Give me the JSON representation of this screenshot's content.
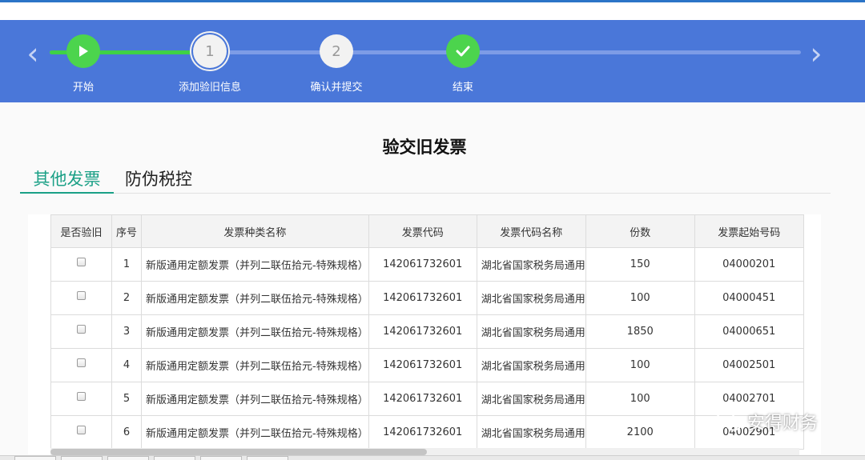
{
  "steps": {
    "items": [
      {
        "label": "开始",
        "icon": "play-icon"
      },
      {
        "label": "添加验旧信息",
        "number": "1"
      },
      {
        "label": "确认并提交",
        "number": "2"
      },
      {
        "label": "结束",
        "icon": "check-icon"
      }
    ],
    "current_index": 1,
    "accent_color": "#4cd44d",
    "bar_color": "#4a77d9"
  },
  "page": {
    "title": "验交旧发票"
  },
  "tabs": [
    {
      "label": "其他发票",
      "active": true
    },
    {
      "label": "防伪税控",
      "active": false
    }
  ],
  "table": {
    "headers": [
      "是否验旧",
      "序号",
      "发票种类名称",
      "发票代码",
      "发票代码名称",
      "份数",
      "发票起始号码"
    ],
    "rows": [
      {
        "seq": "1",
        "name": "新版通用定额发票（并列二联伍拾元-特殊规格）",
        "code": "142061732601",
        "code_name": "湖北省国家税务局通用",
        "count": "150",
        "start": "04000201",
        "checked": false
      },
      {
        "seq": "2",
        "name": "新版通用定额发票（并列二联伍拾元-特殊规格）",
        "code": "142061732601",
        "code_name": "湖北省国家税务局通用",
        "count": "100",
        "start": "04000451",
        "checked": false
      },
      {
        "seq": "3",
        "name": "新版通用定额发票（并列二联伍拾元-特殊规格）",
        "code": "142061732601",
        "code_name": "湖北省国家税务局通用",
        "count": "1850",
        "start": "04000651",
        "checked": false
      },
      {
        "seq": "4",
        "name": "新版通用定额发票（并列二联伍拾元-特殊规格）",
        "code": "142061732601",
        "code_name": "湖北省国家税务局通用",
        "count": "100",
        "start": "04002501",
        "checked": false
      },
      {
        "seq": "5",
        "name": "新版通用定额发票（并列二联伍拾元-特殊规格）",
        "code": "142061732601",
        "code_name": "湖北省国家税务局通用",
        "count": "100",
        "start": "04002701",
        "checked": false
      },
      {
        "seq": "6",
        "name": "新版通用定额发票（并列二联伍拾元-特殊规格）",
        "code": "142061732601",
        "code_name": "湖北省国家税务局通用",
        "count": "2100",
        "start": "04002901",
        "checked": false
      }
    ]
  },
  "watermark": {
    "text": "安得财务",
    "icon": "wechat-icon"
  }
}
